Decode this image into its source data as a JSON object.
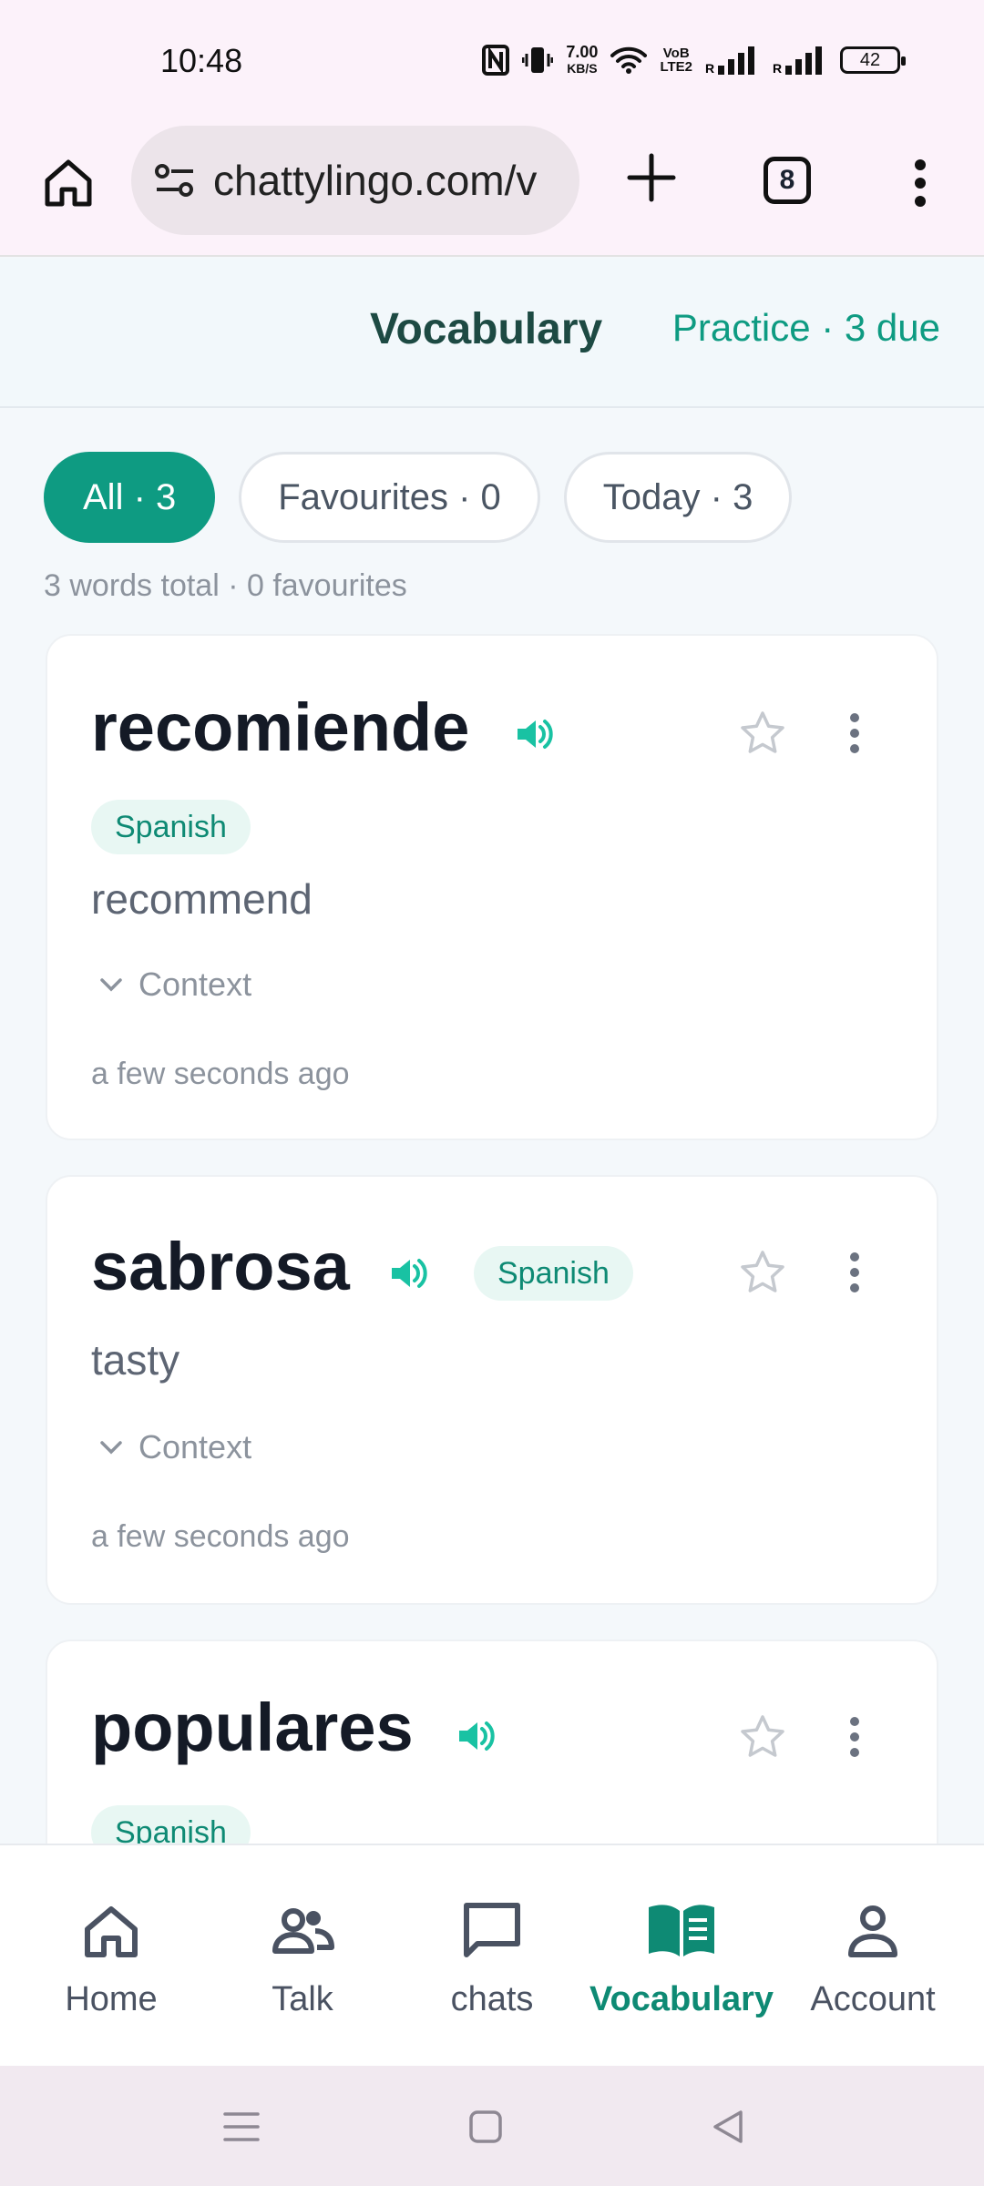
{
  "status_bar": {
    "time": "10:48",
    "speed_value": "7.00",
    "speed_unit": "KB/S",
    "volte_top": "VoB",
    "volte_bottom": "LTE2",
    "battery": "42"
  },
  "browser": {
    "url": "chattylingo.com/v",
    "tab_count": "8"
  },
  "header": {
    "title": "Vocabulary",
    "practice": "Practice · 3 due"
  },
  "filters": [
    {
      "label": "All · 3",
      "active": true
    },
    {
      "label": "Favourites · 0",
      "active": false
    },
    {
      "label": "Today · 3",
      "active": false
    }
  ],
  "summary": "3 words total · 0 favourites",
  "cards": [
    {
      "word": "recomiende",
      "language": "Spanish",
      "translation": "recommend",
      "context_label": "Context",
      "timestamp": "a few seconds ago"
    },
    {
      "word": "sabrosa",
      "language": "Spanish",
      "translation": "tasty",
      "context_label": "Context",
      "timestamp": "a few seconds ago"
    },
    {
      "word": "populares",
      "language": "Spanish",
      "translation": "",
      "context_label": "",
      "timestamp": ""
    }
  ],
  "bottom_nav": [
    {
      "label": "Home",
      "icon": "home-icon"
    },
    {
      "label": "Talk",
      "icon": "people-icon"
    },
    {
      "label": "chats",
      "icon": "chat-icon"
    },
    {
      "label": "Vocabulary",
      "icon": "book-icon",
      "active": true
    },
    {
      "label": "Account",
      "icon": "person-icon"
    }
  ],
  "colors": {
    "accent": "#0e9b82",
    "header_title": "#1d4a43",
    "speaker": "#19c2a3"
  }
}
